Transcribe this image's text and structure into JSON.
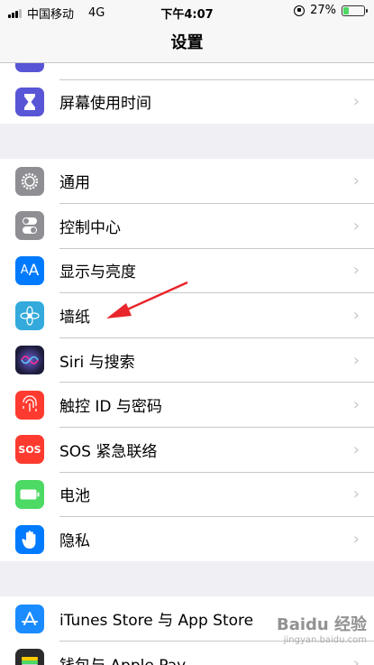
{
  "status": {
    "carrier": "中国移动",
    "network": "4G",
    "time": "下午4:07",
    "battery_percent": "27%",
    "battery_level": 0.27
  },
  "nav": {
    "title": "设置"
  },
  "groups": [
    {
      "items": [
        {
          "label": "",
          "icon": "purple-partial-icon",
          "color": "#5856d6"
        },
        {
          "label": "屏幕使用时间",
          "icon": "hourglass-icon",
          "color": "#5856d6"
        }
      ]
    },
    {
      "items": [
        {
          "label": "通用",
          "icon": "gear-icon",
          "color": "#8e8e93"
        },
        {
          "label": "控制中心",
          "icon": "toggles-icon",
          "color": "#8e8e93"
        },
        {
          "label": "显示与亮度",
          "icon": "text-size-icon",
          "color": "#007aff"
        },
        {
          "label": "墙纸",
          "icon": "flower-icon",
          "color": "#34aadc"
        },
        {
          "label": "Siri 与搜索",
          "icon": "siri-icon",
          "color": "#1c1c3a"
        },
        {
          "label": "触控 ID 与密码",
          "icon": "fingerprint-icon",
          "color": "#ff3b30"
        },
        {
          "label": "SOS 紧急联络",
          "icon": "sos-icon",
          "color": "#ff3b30",
          "icon_text": "SOS"
        },
        {
          "label": "电池",
          "icon": "battery-icon",
          "color": "#4cd964"
        },
        {
          "label": "隐私",
          "icon": "hand-icon",
          "color": "#007aff"
        }
      ]
    },
    {
      "items": [
        {
          "label": "iTunes Store 与 App Store",
          "icon": "app-store-icon",
          "color": "#1a8cff"
        },
        {
          "label": "钱包与 Apple Pay",
          "icon": "wallet-icon",
          "color": "#2b2b2b"
        }
      ]
    }
  ],
  "watermark": {
    "brand": "Baidu 经验",
    "url": "jingyan.baidu.com"
  }
}
